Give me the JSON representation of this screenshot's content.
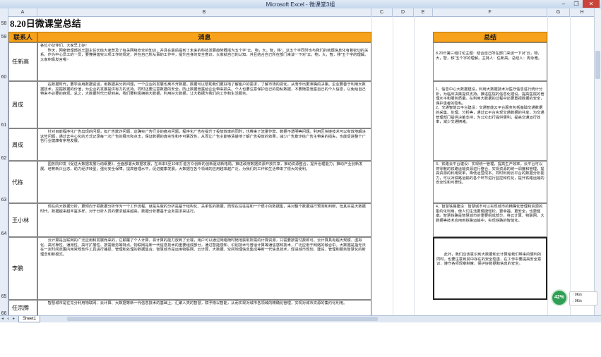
{
  "window": {
    "title": "Microsoft Excel - 微课堂3组",
    "minimize": "–",
    "restore": "❐",
    "close": "✕"
  },
  "columns": [
    "A",
    "B",
    "C",
    "D",
    "E",
    "F",
    "G",
    "H"
  ],
  "rows": [
    "58",
    "59",
    "60",
    "61",
    "62",
    "63",
    "64",
    "65",
    "66",
    "67"
  ],
  "sheet": {
    "title": "8.20日微课堂总结",
    "header_contact": "联系人",
    "header_message": "消息",
    "header_summary": "总结"
  },
  "entries": [
    {
      "contact": "任新高",
      "message": "各位小伙伴们，大家早上好！\n　　昨天，网络管理部的王副主任长给大家普及了有关网络安全的知识，并且在最后提到了未来的科技发展趋势概括为五个字“云，物，大，智，移”。这五个字同时也与我们的就题信息化有着密切的关系，作为中心员工的一员，要懂得落实三项工作的规定，并在自己所从事的工作中，提升自身的安全意识，大家就自己的认知，并且结合自己所在部门来谈一下对“云，物，大，智，移”五个字的理解。\n大家积极发言哦~"
    },
    {
      "contact": "周成",
      "message": "　　在数据时代，要学会用数据说话，用数据来分析问题，一个企业的发展也离不开数据，数据可以帮助我们更好地了解客户的需求，了解市场的变化，从而作出更准确的决策。企业要善于利用大数据技术，挖掘数据的价值，为企业的发展提供有力的支持。同时还要注意数据的安全，防止数据泄露给企业带来损失。个人也要注意保护自己的隐私数据，不要随意泄露自己的个人信息，以免给自己带来不必要的麻烦。总之，大数据时代已经到来，我们要积极拥抱大数据，利用好大数据，让大数据为我们的工作和生活服务。"
    },
    {
      "contact": "周成",
      "message": "　　针对目前程序化广告出现的问题，如广告欺诈问题，这确实广告行业的痛点问题，程序化广告在提升了投放效率的同时，也带来了流量作弊、数据不透明等问题。利用区块链技术可以有效地解决这些问题，通过去中心化的方式记录每一次广告的展示和点击，保证数据的真实性和不可篡改性，从而让广告主能够清楚地了解广告投放的效果，减少广告欺诈给广告主带来的损失，也能促进整个广告行业健康有序地发展。"
    },
    {
      "contact": "代栋",
      "message": "　　国务院印发《促进大数据发展行动纲要》，全面部署大数据发展，在未来5至10年打造方众创新的创新驱动新格局。推进政府数据资源开放共享，推动资源整合，提升治理能力；推动产业创新发展，培育新兴业态，助力经济转型；强化安全保障，提高管理水平，促进健康发展。大数据在各个领域的应用越来越广泛，为我们的工作和生活带来了很大的便利。"
    },
    {
      "contact": "王小林",
      "message": "　　现在的大数据分析，更倾向于把数据分析作为一个工作流程，就是先做的分析是基于结构化、关系性的数据，而现在往往是和一个很小的数据集，来对整个数据进行预测和判断，但其实是大数据时代，数据越来越丰富多样，对于分析人员的要求越来越高，数据分析要基于业务需求来进行。"
    },
    {
      "contact": "李鹏",
      "message": "　　云计算是互联网的广泛应用和发展而来的，它颠覆了个人计算，将计算的能力放到了云端，用户可以通过网络随时随地获取所需的计算资源，只需要按需付费即可。云计算具有超大规模、虚拟化、高可靠性、通用性、高可扩展性、按需服务等特点。物联网是新一代信息技术的重要组成部分，通过智能感知、识别技术与普适计算等通信感知技术，广泛应用于网络的融合中。大数据是指无法在一定时间范围内用常规软件工具进行捕捉、管理和处理的数据集合。智慧城市是运用物联网、云计算、大数据、空间地理信息集成等新一代信息技术，促进城市规划、建设、管理和服务智慧化的新理念和新模式。"
    },
    {
      "contact": "任宗腾",
      "message": "　　智慧城市是在充分利用物联网、云计算、大数据等新一代信息技术的基础上，汇聚人类的智慧，赋予物以智能，从而实现对城市各领域的精确化管理，实现对城市资源的集约化利用。"
    }
  ],
  "summaries": [
    "8.20日第三组讨论主题：结合自己所在部门来谈一下对“云，物，大，智，移”五个字的理解。主持人：任新高。总结人：周永雅。",
    "1、信息中心大数据建设，利用大数据技术对医疗信息进行统计分析，为临床决策提供支持，推进医院的信息化建设，提高医院的管理水平和服务质量。在利用大数据的过程中还要重视数据的安全，保护患者的隐私。\n2、交通智能云平台建设：交通智能云平台服务包括基础交通数据的采集、处理、分析等，通过云平台实现交通数据的共享，为交通管理部门提供决策支持，为公众出行提供便利，提高交通运行效率，减少交通拥堵。",
    "3、铁路云平台建设：实现统一管理，提高生产效率。云平台可以将零散的铁路运输资源进行整合，实现资源的统一调度和管理，提高资源的利用效率，降低运营成本。同时利用云平台的数据分析能力，可以对铁路运输的各个环节进行监控和优化，提升铁路运输的安全性和可靠性。",
    "4、智慧铁路建设：智慧城市可以实现城市的精确化管理和资源的集约化利用，使人们生活更便捷轻松，更幸福、更安全，也更健康。智慧铁路是智慧城市的重要组成部分，将云计算、物联网、大数据等技术应用到铁路运输中，实现铁路的智能化。",
    "　　此外，我们应该意识到大数据和云计算给我们带来的便利的同时，也要注意到其中存在的安全隐患，在工作中要提高安全意识，遵守各项规章制度，保护好数据和信息的安全。"
  ],
  "sheet_tab": "Sheet1",
  "widget": {
    "percent": "42%",
    "up": "0K/s",
    "down": "0K/s"
  }
}
